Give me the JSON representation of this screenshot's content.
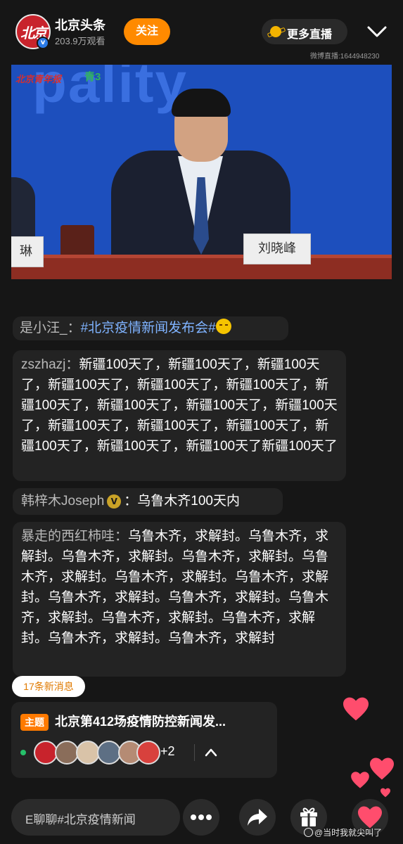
{
  "header": {
    "account_name": "北京头条",
    "viewers": "203.9万观看",
    "follow_label": "关注",
    "more_live_label": "更多直播",
    "room_id": "微博直播:1644948230",
    "logo_text": "北京"
  },
  "video": {
    "backdrop_text": "pality",
    "brand_text": "北京青年报",
    "brand2_text": "青3",
    "left_nameplate": "琳",
    "speaker_nameplate": "刘晓峰"
  },
  "comments": [
    {
      "user": "是小汪_：",
      "tag": "#北京疫情新闻发布会#",
      "text": ""
    },
    {
      "user": "zszhazj：",
      "text": "新疆100天了，新疆100天了，新疆100天了，新疆100天了，新疆100天了，新疆100天了，新疆100天了，新疆100天了，新疆100天了，新疆100天了，新疆100天了，新疆100天了，新疆100天了，新疆100天了，新疆100天了，新疆100天了新疆100天了"
    },
    {
      "user": "韩梓木Joseph",
      "text": "：乌鲁木齐100天内"
    },
    {
      "user": "暴走的西红柿哇：",
      "text": "乌鲁木齐，求解封。乌鲁木齐，求解封。乌鲁木齐，求解封。乌鲁木齐，求解封。乌鲁木齐，求解封。乌鲁木齐，求解封。乌鲁木齐，求解封。乌鲁木齐，求解封。乌鲁木齐，求解封。乌鲁木齐，求解封。乌鲁木齐，求解封。乌鲁木齐，求解封。乌鲁木齐，求解封。乌鲁木齐，求解封"
    }
  ],
  "new_messages": "17条新消息",
  "topic": {
    "badge": "主题",
    "title": "北京第412场疫情防控新闻发...",
    "extra_count": "+2"
  },
  "bottom_bar": {
    "input_text": "E聊聊#北京疫情新闻",
    "icons": [
      "more-icon",
      "share-icon",
      "gift-icon",
      "like-heart-icon"
    ]
  },
  "watermark": "@当时我就尖叫了",
  "colors": {
    "accent": "#ff8a00",
    "topic_tag": "#7fb3ff",
    "heart": "#ff4d6d"
  }
}
